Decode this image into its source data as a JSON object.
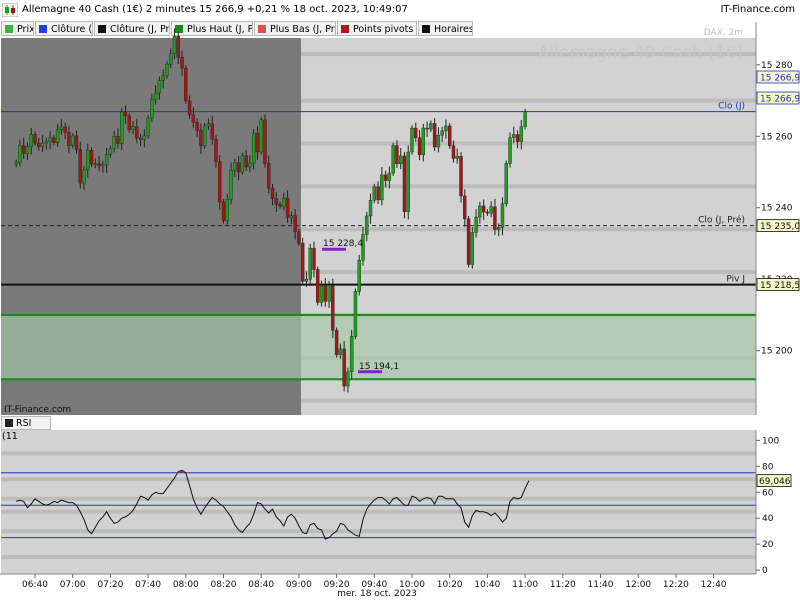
{
  "header": {
    "title": "Allemagne 40 Cash (1€) 2 minutes 15 266,9 +0,21 % 18 oct. 2023, 10:49:07",
    "brand": "IT-Finance.com"
  },
  "legend": [
    {
      "label": "Prix",
      "color": "#3cb043"
    },
    {
      "label": "Clôture (J",
      "color": "#1f3fd8"
    },
    {
      "label": "Clôture (J, Pré",
      "color": "#111111"
    },
    {
      "label": "Plus Haut (J, Pr",
      "color": "#1a8a1a"
    },
    {
      "label": "Plus Bas (J, Pré",
      "color": "#e05050"
    },
    {
      "label": "Points pivots (",
      "color": "#b01818"
    },
    {
      "label": "Horaires",
      "color": "#111111"
    }
  ],
  "rsi_tab": "RSI (11",
  "colors": {
    "up": "#1e9e1e",
    "down": "#a01818",
    "shade": "#7a7a7a",
    "plot_bg": "#d2d2d2",
    "zone": "#a8c8a8",
    "blue_line": "#2233cc",
    "green_line": "#1b8a1b",
    "tag_bg": "#f5f5c8"
  },
  "chart_data": [
    {
      "type": "candlestick",
      "title": "Allemagne 40 Cash (1€)",
      "subtitle": "DAX, 2m",
      "watermark": "IT-Finance.com",
      "x_ticks": [
        "06:40",
        "07:00",
        "07:20",
        "07:40",
        "08:00",
        "08:20",
        "08:40",
        "09:00",
        "09:20",
        "09:40",
        "10:00",
        "10:20",
        "10:40",
        "11:00",
        "11:20",
        "11:40",
        "12:00",
        "12:20",
        "12:40"
      ],
      "x_date_label": "mer. 18 oct. 2023",
      "y_ticks": [
        15280,
        15260,
        15240,
        15220,
        15200
      ],
      "y_tick_labels": [
        "15 280",
        "15 260",
        "15 240",
        "15 220",
        "15 200"
      ],
      "ylim": [
        15182,
        15287.5
      ],
      "grid": true,
      "first_bar_time": "06:30",
      "bar_minutes": 2,
      "closes": [
        15252.7,
        15257.4,
        15255.2,
        15257.1,
        15260.5,
        15258.1,
        15257.1,
        15258.1,
        15258.5,
        15259.6,
        15258.2,
        15261.9,
        15262.6,
        15261.1,
        15257.4,
        15260.1,
        15256.3,
        15246.9,
        15250.6,
        15256.1,
        15252.2,
        15252.3,
        15251.7,
        15252.0,
        15254.9,
        15256.6,
        15260.0,
        15258.0,
        15266.8,
        15265.7,
        15261.8,
        15262.7,
        15259.5,
        15259.1,
        15260.1,
        15265.1,
        15270.4,
        15272.1,
        15275.6,
        15276.9,
        15280.2,
        15283.1,
        15288.0,
        15282.1,
        15279.1,
        15269.9,
        15266.0,
        15263.9,
        15261.7,
        15257.3,
        15262.9,
        15263.5,
        15259.2,
        15252.9,
        15241.6,
        15236.4,
        15242.4,
        15250.5,
        15252.6,
        15250.0,
        15254.6,
        15251.4,
        15252.5,
        15260.9,
        15255.6,
        15264.6,
        15252.4,
        15245.5,
        15242.5,
        15241.0,
        15240.4,
        15242.7,
        15237.3,
        15237.8,
        15233.3,
        15230.1,
        15219.4,
        15220.0,
        15228.7,
        15222.7,
        15213.5,
        15218.1,
        15213.8,
        15218.3,
        15205.7,
        15198.9,
        15200.5,
        15190.1,
        15194.1,
        15204.0,
        15216.6,
        15225.3,
        15232.5,
        15237.7,
        15242.1,
        15245.9,
        15242.2,
        15249.2,
        15247.6,
        15249.7,
        15257.4,
        15252.3,
        15254.5,
        15238.9,
        15255.6,
        15262.3,
        15259.6,
        15254.8,
        15262.3,
        15262.0,
        15263.6,
        15257.0,
        15260.3,
        15261.5,
        15262.9,
        15257.3,
        15253.8,
        15254.4,
        15243.3,
        15236.9,
        15224.1,
        15233.1,
        15237.4,
        15240.5,
        15238.8,
        15238.5,
        15240.3,
        15233.9,
        15234.5,
        15241.1,
        15252.4,
        15259.6,
        15260.5,
        15258.5,
        15262.7,
        15266.9
      ],
      "y_tags": [
        {
          "label": "15 266,9",
          "value": 15266.9,
          "color": "#2233cc"
        },
        {
          "label": "15 266,9",
          "value": 15266.9,
          "color": "#2233cc"
        },
        {
          "label": "15 235,0",
          "value": 15235.0,
          "color": "#111111"
        },
        {
          "label": "15 218,5",
          "value": 15218.5,
          "color": "#111111"
        }
      ],
      "levels": [
        {
          "name": "Clo (J)",
          "value": 15266.9,
          "style": "solid-blue"
        },
        {
          "name": "Clo (J, Pré)",
          "value": 15235.0,
          "style": "dashed"
        },
        {
          "name": "Piv J",
          "value": 15218.5,
          "style": "solid-black"
        }
      ],
      "zone": [
        15192,
        15210
      ],
      "markers": [
        {
          "label": "15 228,4",
          "value": 15228.4
        },
        {
          "label": "15 194,1",
          "value": 15194.1
        }
      ],
      "hidden_tick_label": "15 220"
    },
    {
      "type": "line",
      "title": "RSI (11",
      "y_ticks": [
        100,
        80,
        60,
        40,
        20,
        0
      ],
      "ylim": [
        -3,
        108
      ],
      "levels": [
        75,
        50,
        25
      ],
      "last_value_label": "69,046",
      "last_value": 69.0,
      "values": [
        53,
        54,
        53,
        48,
        51,
        55,
        53,
        51,
        50,
        51,
        53,
        52,
        54,
        53,
        52,
        52,
        50,
        45,
        39,
        31,
        28,
        33,
        38,
        41,
        45,
        40,
        36,
        37,
        40,
        41,
        43,
        46,
        51,
        57,
        56,
        54,
        58,
        60,
        59,
        59,
        63,
        67,
        71,
        76,
        77,
        75,
        65,
        55,
        48,
        43,
        48,
        52,
        56,
        54,
        51,
        49,
        45,
        41,
        35,
        31,
        29,
        33,
        36,
        43,
        52,
        51,
        47,
        44,
        47,
        41,
        38,
        34,
        41,
        43,
        40,
        34,
        29,
        28,
        35,
        36,
        32,
        31,
        24,
        25,
        28,
        30,
        36,
        35,
        31,
        29,
        27,
        26,
        39,
        47,
        51,
        54,
        56,
        56,
        54,
        51,
        55,
        56,
        53,
        50,
        50,
        57,
        56,
        53,
        55,
        56,
        55,
        51,
        57,
        57,
        55,
        55,
        55,
        51,
        48,
        37,
        33,
        42,
        46,
        45,
        45,
        44,
        42,
        44,
        41,
        37,
        40,
        53,
        56,
        55,
        56,
        63,
        69
      ]
    }
  ]
}
